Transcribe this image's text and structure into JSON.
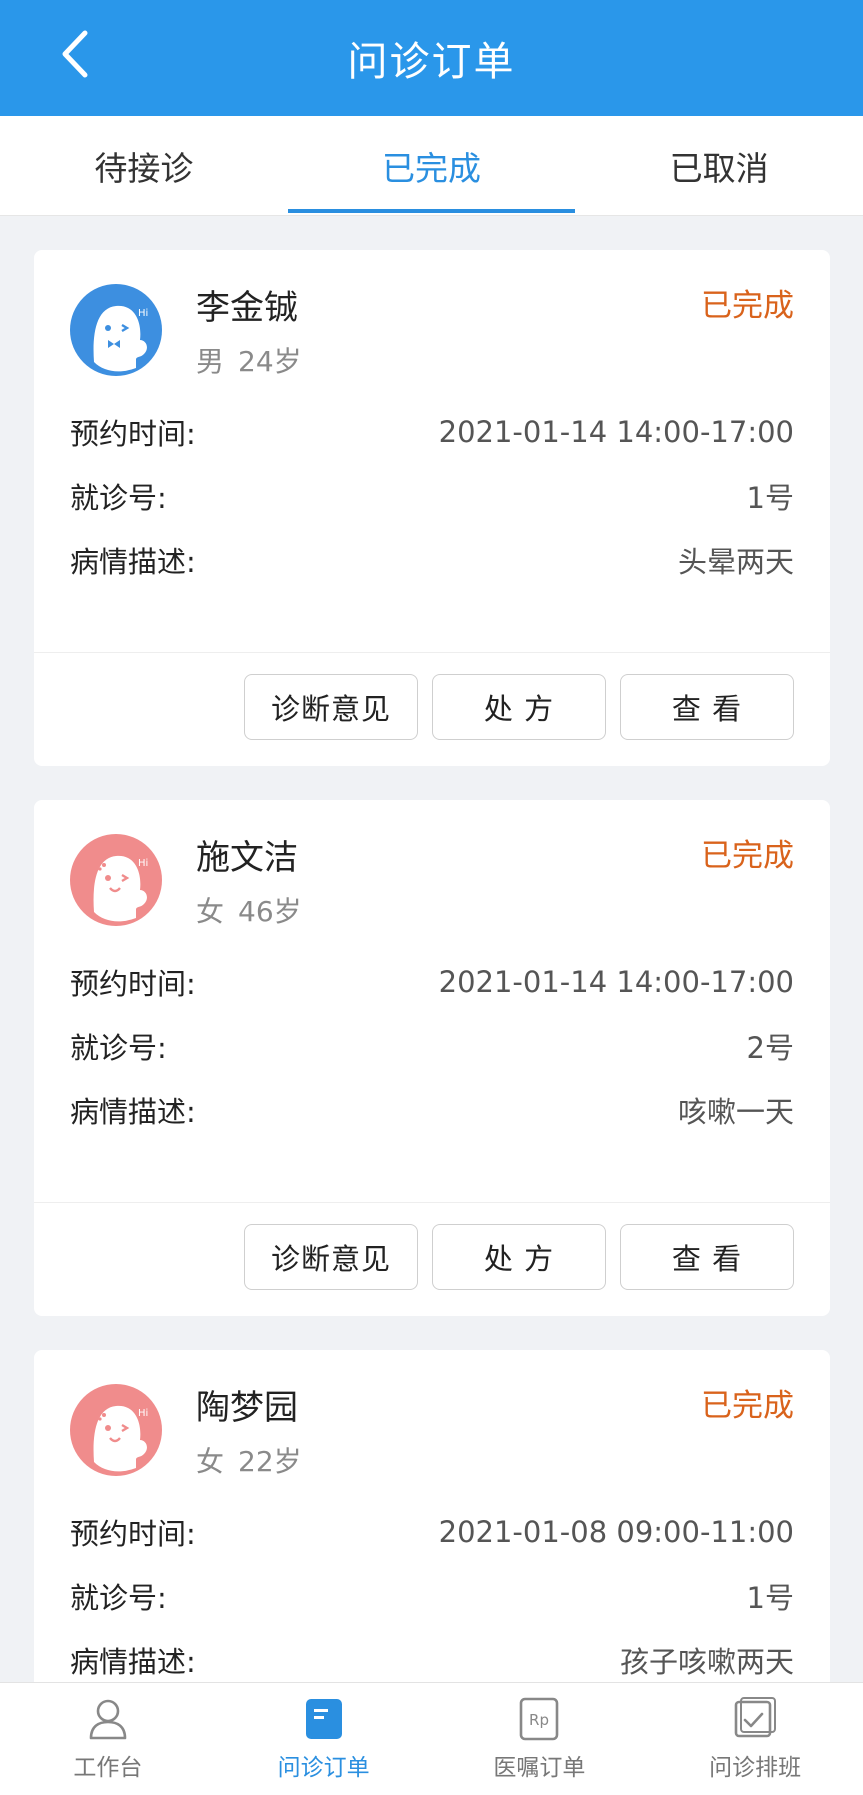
{
  "header": {
    "title": "问诊订单"
  },
  "tabs": [
    {
      "label": "待接诊",
      "active": false
    },
    {
      "label": "已完成",
      "active": true
    },
    {
      "label": "已取消",
      "active": false
    }
  ],
  "row_labels": {
    "appointment": "预约时间:",
    "number": "就诊号:",
    "description": "病情描述:"
  },
  "buttons": {
    "diagnosis": "诊断意见",
    "prescription": "处 方",
    "view": "查 看"
  },
  "orders": [
    {
      "name": "李金铖",
      "gender": "男",
      "age": "24岁",
      "status": "已完成",
      "time": "2021-01-14 14:00-17:00",
      "number": "1号",
      "description": "头晕两天",
      "avatar_color": "#3d8fe0"
    },
    {
      "name": "施文洁",
      "gender": "女",
      "age": "46岁",
      "status": "已完成",
      "time": "2021-01-14 14:00-17:00",
      "number": "2号",
      "description": "咳嗽一天",
      "avatar_color": "#f08c8c"
    },
    {
      "name": "陶梦园",
      "gender": "女",
      "age": "22岁",
      "status": "已完成",
      "time": "2021-01-08 09:00-11:00",
      "number": "1号",
      "description": "孩子咳嗽两天",
      "avatar_color": "#f08c8c"
    }
  ],
  "bottom_nav": [
    {
      "label": "工作台",
      "icon": "user-icon",
      "active": false
    },
    {
      "label": "问诊订单",
      "icon": "order-icon",
      "active": true
    },
    {
      "label": "医嘱订单",
      "icon": "rp-icon",
      "active": false
    },
    {
      "label": "问诊排班",
      "icon": "schedule-icon",
      "active": false
    }
  ],
  "colors": {
    "brand": "#2a97ea",
    "status": "#d9631c"
  }
}
